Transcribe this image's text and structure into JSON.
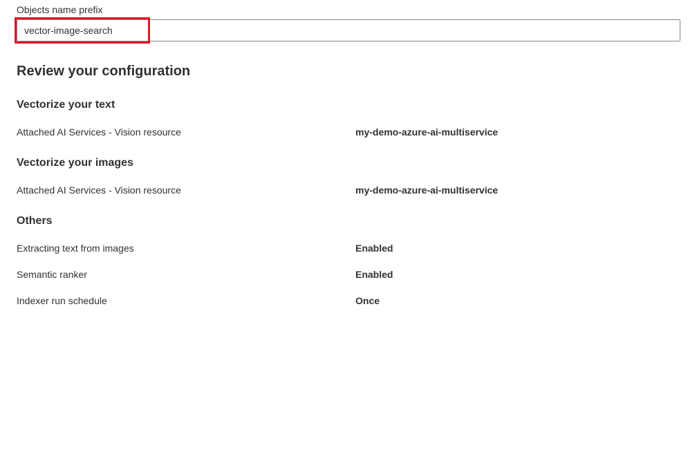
{
  "prefix": {
    "label": "Objects name prefix",
    "value": "vector-image-search"
  },
  "review": {
    "heading": "Review your configuration"
  },
  "vectorize_text": {
    "heading": "Vectorize your text",
    "row1": {
      "label": "Attached AI Services - Vision resource",
      "value": "my-demo-azure-ai-multiservice"
    }
  },
  "vectorize_images": {
    "heading": "Vectorize your images",
    "row1": {
      "label": "Attached AI Services - Vision resource",
      "value": "my-demo-azure-ai-multiservice"
    }
  },
  "others": {
    "heading": "Others",
    "row1": {
      "label": "Extracting text from images",
      "value": "Enabled"
    },
    "row2": {
      "label": "Semantic ranker",
      "value": "Enabled"
    },
    "row3": {
      "label": "Indexer run schedule",
      "value": "Once"
    }
  }
}
